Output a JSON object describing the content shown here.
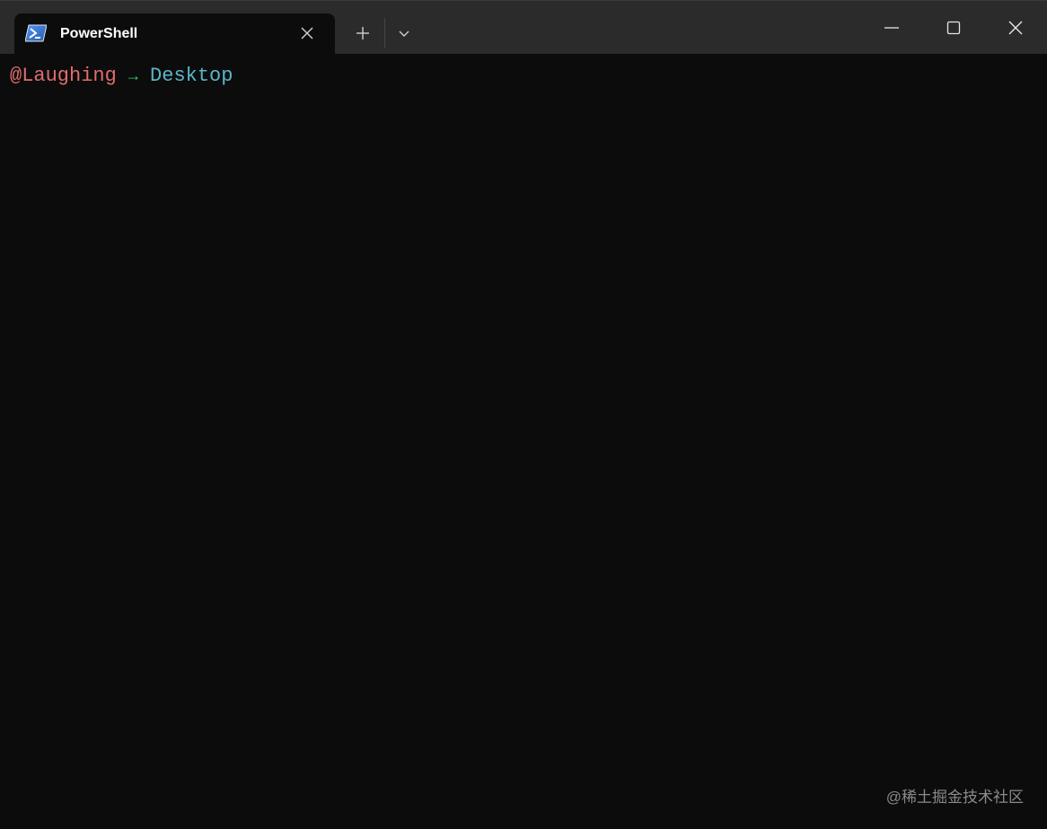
{
  "tab": {
    "title": "PowerShell",
    "icon": "powershell-icon"
  },
  "toolbar": {
    "new_tab_icon": "plus-icon",
    "dropdown_icon": "chevron-down-icon"
  },
  "window_controls": {
    "minimize_icon": "minimize-icon",
    "maximize_icon": "maximize-icon",
    "close_icon": "close-icon"
  },
  "terminal": {
    "user": "@Laughing",
    "arrow": "→",
    "directory": "Desktop"
  },
  "watermark": "@稀土掘金技术社区",
  "colors": {
    "titlebar_bg": "#2b2b2b",
    "terminal_bg": "#0c0c0c",
    "user_color": "#e06c6c",
    "arrow_color": "#3fc56b",
    "directory_color": "#5ab5c8"
  }
}
